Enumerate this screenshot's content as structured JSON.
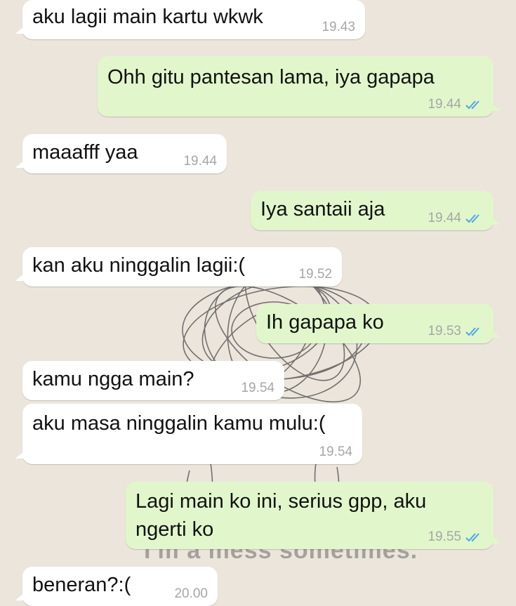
{
  "messages": [
    {
      "text": "aku lagii main kartu wkwk",
      "time": "19.43",
      "side": "in"
    },
    {
      "text": "Ohh gitu pantesan lama, iya gapapa",
      "time": "19.44",
      "side": "out",
      "read": true
    },
    {
      "text": "maaafff yaa",
      "time": "19.44",
      "side": "in"
    },
    {
      "text": "Iya santaii aja",
      "time": "19.44",
      "side": "out",
      "read": true
    },
    {
      "text": "kan aku ninggalin lagii:(",
      "time": "19.52",
      "side": "in"
    },
    {
      "text": "Ih gapapa ko",
      "time": "19.53",
      "side": "out",
      "read": true
    },
    {
      "text": "kamu ngga main?",
      "time": "19.54",
      "side": "in"
    },
    {
      "text": "aku masa ninggalin kamu mulu:(",
      "time": "19.54",
      "side": "in"
    },
    {
      "text": "Lagi main ko ini, serius gpp, aku ngerti ko",
      "time": "19.55",
      "side": "out",
      "read": true
    },
    {
      "text": "beneran?:(",
      "time": "20.00",
      "side": "in"
    }
  ],
  "wallpaper": {
    "caption": "I'm a mess sometimes."
  },
  "colors": {
    "background": "#ece5dc",
    "incoming": "#ffffff",
    "outgoing": "#e1f7cb",
    "read_ticks": "#4fa6e8",
    "timestamp": "#a6a6a6"
  }
}
